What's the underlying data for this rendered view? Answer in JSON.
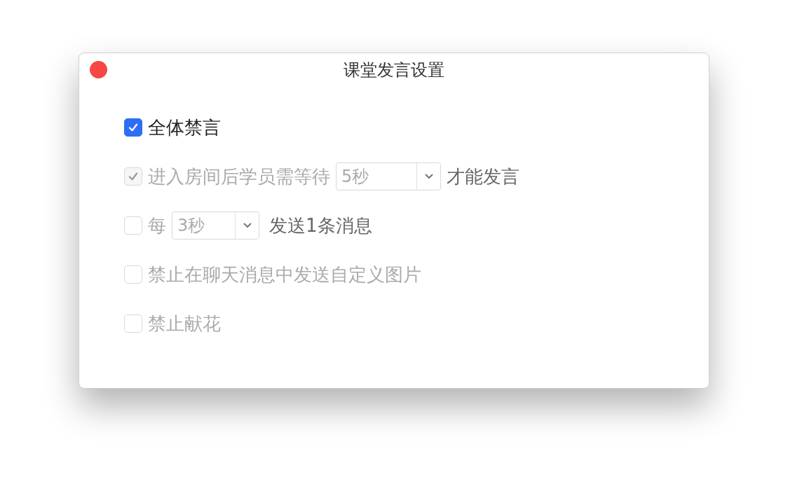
{
  "window": {
    "title": "课堂发言设置"
  },
  "options": [
    {
      "kind": "plain",
      "label": "全体禁言",
      "checked": true,
      "disabled": false
    },
    {
      "kind": "with-select",
      "label": "进入房间后学员需等待",
      "select": {
        "value": "5秒"
      },
      "label_after": "才能发言",
      "checked": true,
      "disabled": true
    },
    {
      "kind": "with-select",
      "label": "每",
      "select": {
        "value": "3秒"
      },
      "label_after": "发送1条消息",
      "checked": false,
      "disabled": true
    },
    {
      "kind": "plain",
      "label": "禁止在聊天消息中发送自定义图片",
      "checked": false,
      "disabled": true
    },
    {
      "kind": "plain",
      "label": "禁止献花",
      "checked": false,
      "disabled": true
    }
  ]
}
